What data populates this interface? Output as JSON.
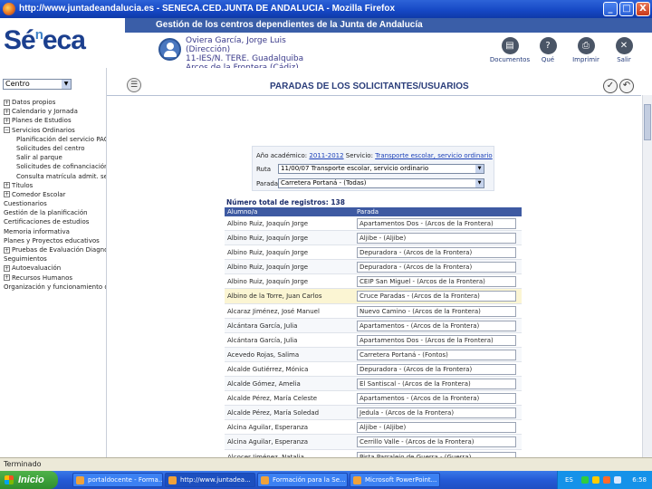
{
  "window": {
    "title": "http://www.juntadeandalucia.es - SENECA.CED.JUNTA DE ANDALUCIA - Mozilla Firefox",
    "minimize": "_",
    "maximize": "□",
    "close": "X"
  },
  "header": {
    "band_title": "Gestión de los centros dependientes de la Junta de Andalucía",
    "logo_main": "Sé",
    "logo_sup": "n",
    "logo_rest": "eca",
    "user_lines": [
      "Oviera García, Jorge Luis",
      "(Dirección)",
      "11-IES/N. TERE. Guadalquiba",
      "Arcos de la Frontera (Cádiz)"
    ],
    "tools": [
      {
        "icon": "▤",
        "label": "Documentos"
      },
      {
        "icon": "?",
        "label": "Qué"
      },
      {
        "icon": "⎙",
        "label": "Imprimir"
      },
      {
        "icon": "✕",
        "label": "Salir"
      }
    ]
  },
  "sidebar": {
    "profile": "Centro",
    "items": [
      {
        "pm": "+",
        "label": "Datos propios",
        "sub": false
      },
      {
        "pm": "+",
        "label": "Calendario y Jornada",
        "sub": false
      },
      {
        "pm": "+",
        "label": "Planes de Estudios",
        "sub": false
      },
      {
        "pm": "−",
        "label": "Servicios Ordinarios",
        "sub": false
      },
      {
        "pm": "",
        "label": "Planificación del servicio PAC",
        "sub": true
      },
      {
        "pm": "",
        "label": "Solicitudes del centro",
        "sub": true
      },
      {
        "pm": "",
        "label": "Salir al parque",
        "sub": true
      },
      {
        "pm": "",
        "label": "Solicitudes de cofinanciación y inst",
        "sub": true
      },
      {
        "pm": "",
        "label": "Consulta matrícula admit. selec. cert",
        "sub": true
      },
      {
        "pm": "+",
        "label": "Títulos",
        "sub": false
      },
      {
        "pm": "+",
        "label": "Comedor Escolar",
        "sub": false
      },
      {
        "pm": "",
        "label": "Cuestionarios",
        "sub": false
      },
      {
        "pm": "",
        "label": "Gestión de la planificación",
        "sub": false
      },
      {
        "pm": "",
        "label": "Certificaciones de estudios",
        "sub": false
      },
      {
        "pm": "",
        "label": "Memoria informativa",
        "sub": false
      },
      {
        "pm": "",
        "label": "Planes y Proyectos educativos",
        "sub": false
      },
      {
        "pm": "+",
        "label": "Pruebas de Evaluación Diagnóstica",
        "sub": false
      },
      {
        "pm": "",
        "label": "Seguimientos",
        "sub": false
      },
      {
        "pm": "+",
        "label": "Autoevaluación",
        "sub": false
      },
      {
        "pm": "+",
        "label": "Recursos Humanos",
        "sub": false
      },
      {
        "pm": "",
        "label": "Organización y funcionamiento del centro",
        "sub": false
      }
    ]
  },
  "main": {
    "title": "PARADAS DE LOS SOLICITANTES/USUARIOS",
    "form": {
      "year_label": "Año académico:",
      "year_value": "2011-2012",
      "service_label": "Servicio:",
      "service_value": "Transporte escolar, servicio ordinario",
      "ruta_label": "Ruta",
      "ruta_value": "11/00/07 Transporte escolar, servicio ordinario",
      "parada_label": "Parada",
      "parada_value": "Carretera Portaná - (Todas)"
    },
    "total": "Número total de registros: 138",
    "columns": [
      "Alumno/a",
      "Parada"
    ],
    "rows": [
      {
        "name": "Albino Ruiz, Joaquín Jorge",
        "stop": "Apartamentos Dos - (Arcos de la Frontera)"
      },
      {
        "name": "Albino Ruiz, Joaquín Jorge",
        "stop": "Aljibe - (Aljibe)"
      },
      {
        "name": "Albino Ruiz, Joaquín Jorge",
        "stop": "Depuradora - (Arcos de la Frontera)"
      },
      {
        "name": "Albino Ruiz, Joaquín Jorge",
        "stop": "Depuradora - (Arcos de la Frontera)"
      },
      {
        "name": "Albino Ruiz, Joaquín Jorge",
        "stop": "CEIP San Miguel - (Arcos de la Frontera)"
      },
      {
        "name": "Albino de la Torre, Juan Carlos",
        "stop": "Cruce Paradas - (Arcos de la Frontera)"
      },
      {
        "name": "Alcaraz Jiménez, José Manuel",
        "stop": "Nuevo Camino - (Arcos de la Frontera)"
      },
      {
        "name": "Alcántara García, Julia",
        "stop": "Apartamentos - (Arcos de la Frontera)"
      },
      {
        "name": "Alcántara García, Julia",
        "stop": "Apartamentos Dos - (Arcos de la Frontera)"
      },
      {
        "name": "Acevedo Rojas, Salima",
        "stop": "Carretera Portaná - (Fontos)"
      },
      {
        "name": "Alcalde Gutiérrez, Mónica",
        "stop": "Depuradora - (Arcos de la Frontera)"
      },
      {
        "name": "Alcalde Gómez, Amelia",
        "stop": "El Santiscal - (Arcos de la Frontera)"
      },
      {
        "name": "Alcalde Pérez, María Celeste",
        "stop": "Apartamentos - (Arcos de la Frontera)"
      },
      {
        "name": "Alcalde Pérez, María Soledad",
        "stop": "Jedula - (Arcos de la Frontera)"
      },
      {
        "name": "Alcina Aguilar, Esperanza",
        "stop": "Aljibe - (Aljibe)"
      },
      {
        "name": "Alcina Aguilar, Esperanza",
        "stop": "Cerrillo Valle - (Arcos de la Frontera)"
      },
      {
        "name": "Alcocer Jiménez, Natalia",
        "stop": "Pista Parralejo de Guerra - (Guerra)"
      }
    ]
  },
  "status": "Terminado",
  "taskbar": {
    "start": "Inicio",
    "tasks": [
      "portaldocente - Forma...",
      "http://www.juntadea...",
      "Formación para la Se...",
      "Microsoft PowerPoint..."
    ],
    "lang": "ES",
    "clock": "6:58"
  }
}
